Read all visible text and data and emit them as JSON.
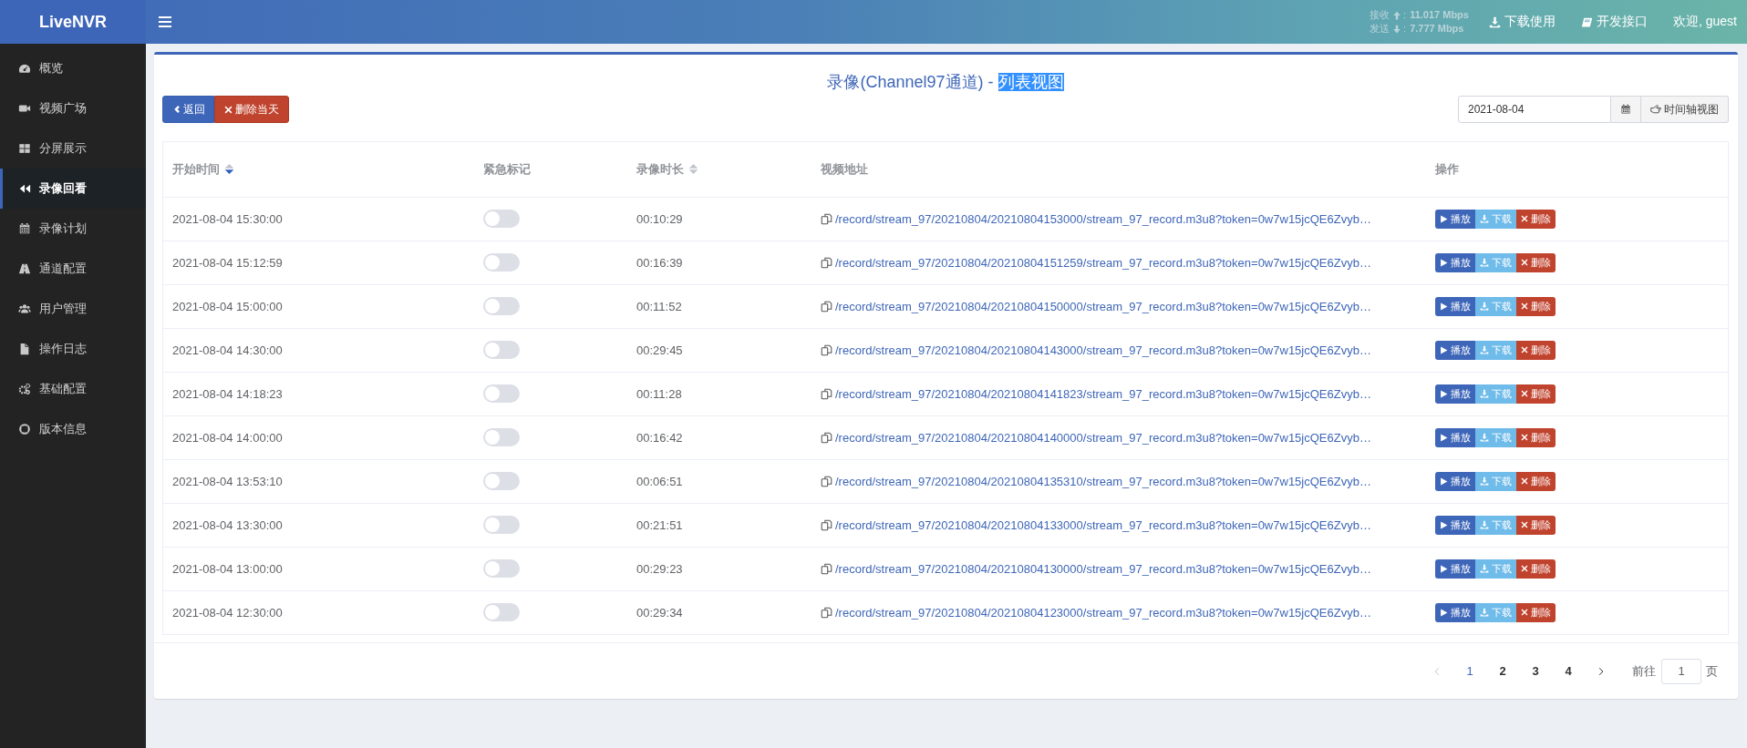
{
  "brand": "LiveNVR",
  "header": {
    "receive_label": "接收",
    "receive_sep": ":",
    "receive_value": "11.017 Mbps",
    "send_label": "发送",
    "send_sep": ":",
    "send_value": "7.777 Mbps",
    "links": [
      {
        "kind": "download",
        "label": "下载使用"
      },
      {
        "kind": "book",
        "label": "开发接口"
      }
    ],
    "welcome": "欢迎, guest"
  },
  "sidebar": {
    "items": [
      {
        "label": "概览",
        "selected": false
      },
      {
        "label": "视频广场",
        "selected": false
      },
      {
        "label": "分屏展示",
        "selected": false
      },
      {
        "label": "录像回看",
        "selected": true
      },
      {
        "label": "录像计划",
        "selected": false
      },
      {
        "label": "通道配置",
        "selected": false
      },
      {
        "label": "用户管理",
        "selected": false
      },
      {
        "label": "操作日志",
        "selected": false
      },
      {
        "label": "基础配置",
        "selected": false
      },
      {
        "label": "版本信息",
        "selected": false
      }
    ]
  },
  "page": {
    "title": "录像(Channel97通道) - ",
    "title_selection": "列表视图",
    "back_button": "返回",
    "delete_day_button": "删除当天",
    "date": "2021-08-04",
    "timeline_button": "时间轴视图"
  },
  "table": {
    "columns": [
      {
        "label": "开始时间",
        "sortable": true,
        "sorted_desc": true
      },
      {
        "label": "紧急标记",
        "sortable": false
      },
      {
        "label": "录像时长",
        "sortable": true,
        "sorted_desc": false
      },
      {
        "label": "视频地址",
        "sortable": false
      },
      {
        "label": "操作",
        "sortable": false
      }
    ],
    "rows": [
      {
        "start": "2021-08-04 15:30:00",
        "urgent": false,
        "duration": "00:10:29",
        "url": "/record/stream_97/20210804/20210804153000/stream_97_record.m3u8?token=0w7w15jcQE6Zvyb…",
        "actions": [
          {
            "kind": "play",
            "label": "播放"
          },
          {
            "kind": "download",
            "label": "下载"
          },
          {
            "kind": "delete",
            "label": "删除"
          }
        ]
      },
      {
        "start": "2021-08-04 15:12:59",
        "urgent": false,
        "duration": "00:16:39",
        "url": "/record/stream_97/20210804/20210804151259/stream_97_record.m3u8?token=0w7w15jcQE6Zvyb…",
        "actions": [
          {
            "kind": "play",
            "label": "播放"
          },
          {
            "kind": "download",
            "label": "下载"
          },
          {
            "kind": "delete",
            "label": "删除"
          }
        ]
      },
      {
        "start": "2021-08-04 15:00:00",
        "urgent": false,
        "duration": "00:11:52",
        "url": "/record/stream_97/20210804/20210804150000/stream_97_record.m3u8?token=0w7w15jcQE6Zvyb…",
        "actions": [
          {
            "kind": "play",
            "label": "播放"
          },
          {
            "kind": "download",
            "label": "下载"
          },
          {
            "kind": "delete",
            "label": "删除"
          }
        ]
      },
      {
        "start": "2021-08-04 14:30:00",
        "urgent": false,
        "duration": "00:29:45",
        "url": "/record/stream_97/20210804/20210804143000/stream_97_record.m3u8?token=0w7w15jcQE6Zvyb…",
        "actions": [
          {
            "kind": "play",
            "label": "播放"
          },
          {
            "kind": "download",
            "label": "下载"
          },
          {
            "kind": "delete",
            "label": "删除"
          }
        ]
      },
      {
        "start": "2021-08-04 14:18:23",
        "urgent": false,
        "duration": "00:11:28",
        "url": "/record/stream_97/20210804/20210804141823/stream_97_record.m3u8?token=0w7w15jcQE6Zvyb…",
        "actions": [
          {
            "kind": "play",
            "label": "播放"
          },
          {
            "kind": "download",
            "label": "下载"
          },
          {
            "kind": "delete",
            "label": "删除"
          }
        ]
      },
      {
        "start": "2021-08-04 14:00:00",
        "urgent": false,
        "duration": "00:16:42",
        "url": "/record/stream_97/20210804/20210804140000/stream_97_record.m3u8?token=0w7w15jcQE6Zvyb…",
        "actions": [
          {
            "kind": "play",
            "label": "播放"
          },
          {
            "kind": "download",
            "label": "下载"
          },
          {
            "kind": "delete",
            "label": "删除"
          }
        ]
      },
      {
        "start": "2021-08-04 13:53:10",
        "urgent": false,
        "duration": "00:06:51",
        "url": "/record/stream_97/20210804/20210804135310/stream_97_record.m3u8?token=0w7w15jcQE6Zvyb…",
        "actions": [
          {
            "kind": "play",
            "label": "播放"
          },
          {
            "kind": "download",
            "label": "下载"
          },
          {
            "kind": "delete",
            "label": "删除"
          }
        ]
      },
      {
        "start": "2021-08-04 13:30:00",
        "urgent": false,
        "duration": "00:21:51",
        "url": "/record/stream_97/20210804/20210804133000/stream_97_record.m3u8?token=0w7w15jcQE6Zvyb…",
        "actions": [
          {
            "kind": "play",
            "label": "播放"
          },
          {
            "kind": "download",
            "label": "下载"
          },
          {
            "kind": "delete",
            "label": "删除"
          }
        ]
      },
      {
        "start": "2021-08-04 13:00:00",
        "urgent": false,
        "duration": "00:29:23",
        "url": "/record/stream_97/20210804/20210804130000/stream_97_record.m3u8?token=0w7w15jcQE6Zvyb…",
        "actions": [
          {
            "kind": "play",
            "label": "播放"
          },
          {
            "kind": "download",
            "label": "下载"
          },
          {
            "kind": "delete",
            "label": "删除"
          }
        ]
      },
      {
        "start": "2021-08-04 12:30:00",
        "urgent": false,
        "duration": "00:29:34",
        "url": "/record/stream_97/20210804/20210804123000/stream_97_record.m3u8?token=0w7w15jcQE6Zvyb…",
        "actions": [
          {
            "kind": "play",
            "label": "播放"
          },
          {
            "kind": "download",
            "label": "下载"
          },
          {
            "kind": "delete",
            "label": "删除"
          }
        ]
      }
    ]
  },
  "pagination": {
    "pages": [
      {
        "label": "1",
        "selected": true
      },
      {
        "label": "2",
        "selected": false
      },
      {
        "label": "3",
        "selected": false
      },
      {
        "label": "4",
        "selected": false
      }
    ],
    "goto_label": "前往",
    "goto_value": "1",
    "goto_suffix": "页"
  }
}
